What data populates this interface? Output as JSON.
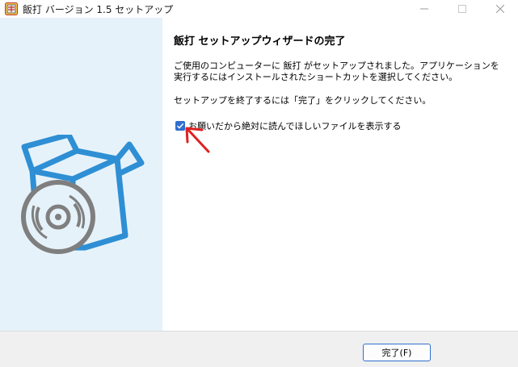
{
  "window": {
    "title": "飯打 バージョン 1.5 セットアップ",
    "icons": {
      "app": "app-icon",
      "minimize": "minimize-icon",
      "maximize": "maximize-icon",
      "close": "close-icon"
    }
  },
  "sidebar": {
    "image": "software-box-with-disc-illustration"
  },
  "main": {
    "heading": "飯打 セットアップウィザードの完了",
    "paragraph1": "ご使用のコンピューターに 飯打 がセットアップされました。アプリケーションを実行するにはインストールされたショートカットを選択してください。",
    "paragraph2": "セットアップを終了するには「完了」をクリックしてください。",
    "checkbox": {
      "label": "お願いだから絶対に読んでほしいファイルを表示する",
      "checked": true
    }
  },
  "annotation": {
    "type": "red-arrow",
    "color": "#e02020"
  },
  "footer": {
    "finish_label": "完了(F)"
  },
  "colors": {
    "accent": "#2f6fcf",
    "sidebar": "#e6f2fa",
    "box_blue": "#2e8fd4",
    "disc_gray": "#7f7f7f"
  }
}
